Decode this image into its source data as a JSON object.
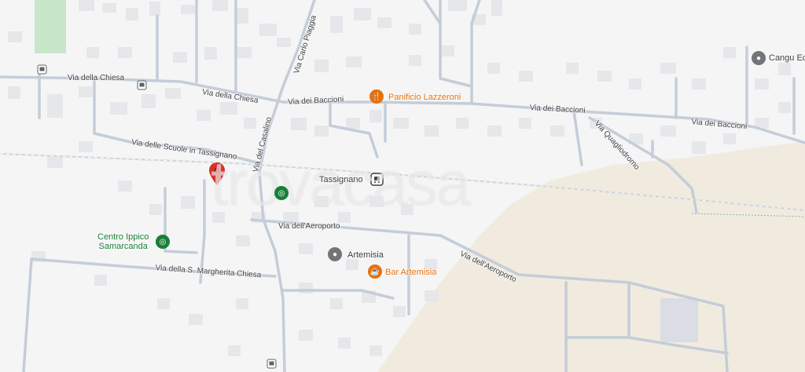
{
  "map": {
    "watermark": "trovacasa",
    "street_labels": {
      "via_della_chiesa_1": "Via della Chiesa",
      "via_della_chiesa_2": "Via della Chiesa",
      "via_dei_baccioni_1": "Via dei Baccioni",
      "via_dei_baccioni_2": "Via dei Baccioni",
      "via_dei_baccioni_3": "Via dei Baccioni",
      "via_carlo_piaggia": "Via Carlo Piaggia",
      "via_del_casalino": "Via del Casalino",
      "via_delle_scuole": "Via delle Scuole in Tassignano",
      "via_quagliodromo": "Via Quagliodromo",
      "via_dell_aeroporto_1": "Via dell'Aeroporto",
      "via_dell_aeroporto_2": "Via dell'Aeroporto",
      "via_s_margherita": "Via della S. Margherita Chiesa"
    },
    "pois": {
      "panificio": "Panificio Lazzeroni",
      "tassignano": "Tassignano",
      "centro_ippico": "Centro Ippico Samarcanda",
      "centro_ippico_line1": "Centro Ippico",
      "centro_ippico_line2": "Samarcanda",
      "artemisia": "Artemisia",
      "bar_artemisia": "Bar Artemisia",
      "cangu": "Cangu Ec"
    },
    "colors": {
      "background": "#f5f5f6",
      "road": "#c4cdd8",
      "building": "#e8e9eb",
      "airport_area": "#f1ebdf",
      "park": "#c8e6c9",
      "pin_red": "#d93025",
      "poi_orange": "#e8710a",
      "poi_green": "#188038",
      "poi_gray": "#70757a"
    }
  }
}
